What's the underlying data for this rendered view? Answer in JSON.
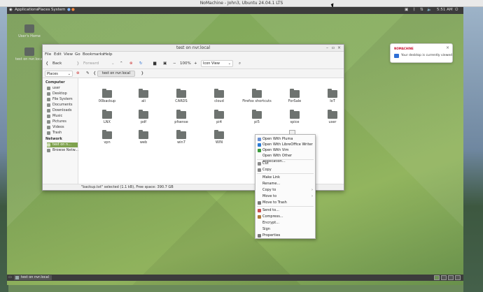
{
  "nomachine": {
    "title": "NoMachine - John3, Ubuntu 24.04.1 LTS"
  },
  "topbar": {
    "applications": "Applications",
    "places": "Places",
    "system": "System",
    "time": "5:51 AM"
  },
  "desktop_icons": [
    {
      "label": "User's Home"
    },
    {
      "label": "test on nvr.local"
    }
  ],
  "notification": {
    "brand": "NOMACHINE",
    "message": "Your desktop is currently viewed"
  },
  "file_manager": {
    "title": "test on nvr.local",
    "menu": [
      "File",
      "Edit",
      "View",
      "Go",
      "Bookmarks",
      "Help"
    ],
    "toolbar": {
      "back": "Back",
      "forward": "Forward",
      "zoom": "100%",
      "view_mode": "Icon View"
    },
    "places_label": "Places",
    "location": "test on nvr.local",
    "sidebar": {
      "computer_header": "Computer",
      "computer_items": [
        "user",
        "Desktop",
        "File System",
        "Documents",
        "Downloads",
        "Music",
        "Pictures",
        "Videos",
        "Trash"
      ],
      "network_header": "Network",
      "network_items": [
        "test on n...",
        "Browse Netw..."
      ]
    },
    "files": [
      {
        "name": "00backup",
        "type": "folder"
      },
      {
        "name": "ali",
        "type": "folder"
      },
      {
        "name": "CARDS",
        "type": "folder"
      },
      {
        "name": "cloud",
        "type": "folder"
      },
      {
        "name": "Firefox shortcuts",
        "type": "folder"
      },
      {
        "name": "ForSale",
        "type": "folder"
      },
      {
        "name": "IoT",
        "type": "folder"
      },
      {
        "name": "LNX",
        "type": "folder"
      },
      {
        "name": "pdf",
        "type": "folder"
      },
      {
        "name": "pfsense",
        "type": "folder"
      },
      {
        "name": "pi4",
        "type": "folder"
      },
      {
        "name": "pi5",
        "type": "folder"
      },
      {
        "name": "spice",
        "type": "folder"
      },
      {
        "name": "user",
        "type": "folder"
      },
      {
        "name": "vpn",
        "type": "folder"
      },
      {
        "name": "web",
        "type": "folder"
      },
      {
        "name": "win7",
        "type": "folder"
      },
      {
        "name": "WIN",
        "type": "folder"
      },
      {
        "name": "backu",
        "type": "file"
      }
    ],
    "status": "\"backup.txt\" selected (1.1 kB), Free space: 390.7 GB"
  },
  "context_menu": {
    "items": [
      {
        "label": "Open With Pluma",
        "icon_color": "#6a8fd0",
        "submenu": false
      },
      {
        "label": "Open With LibreOffice Writer",
        "icon_color": "#2a7ad5",
        "submenu": false
      },
      {
        "label": "Open With Vim",
        "icon_color": "#3a9a3a",
        "submenu": false
      },
      {
        "label": "Open With Other Application...",
        "icon_color": "",
        "submenu": false
      },
      {
        "label": "Cut",
        "icon_color": "#888888",
        "submenu": false
      },
      {
        "label": "Copy",
        "icon_color": "#888888",
        "submenu": false
      },
      {
        "label": "Make Link",
        "icon_color": "",
        "submenu": false
      },
      {
        "label": "Rename...",
        "icon_color": "",
        "submenu": false
      },
      {
        "label": "Copy to",
        "icon_color": "",
        "submenu": true
      },
      {
        "label": "Move to",
        "icon_color": "",
        "submenu": true
      },
      {
        "label": "Move to Trash",
        "icon_color": "#7a7a7a",
        "submenu": false
      },
      {
        "label": "Send to...",
        "icon_color": "#c85050",
        "submenu": false
      },
      {
        "label": "Compress...",
        "icon_color": "#b07a3a",
        "submenu": false
      },
      {
        "label": "Encrypt...",
        "icon_color": "",
        "submenu": false
      },
      {
        "label": "Sign",
        "icon_color": "",
        "submenu": false
      },
      {
        "label": "Properties",
        "icon_color": "#777777",
        "submenu": false
      }
    ]
  },
  "bottom_panel": {
    "task": "test on nvr.local"
  }
}
